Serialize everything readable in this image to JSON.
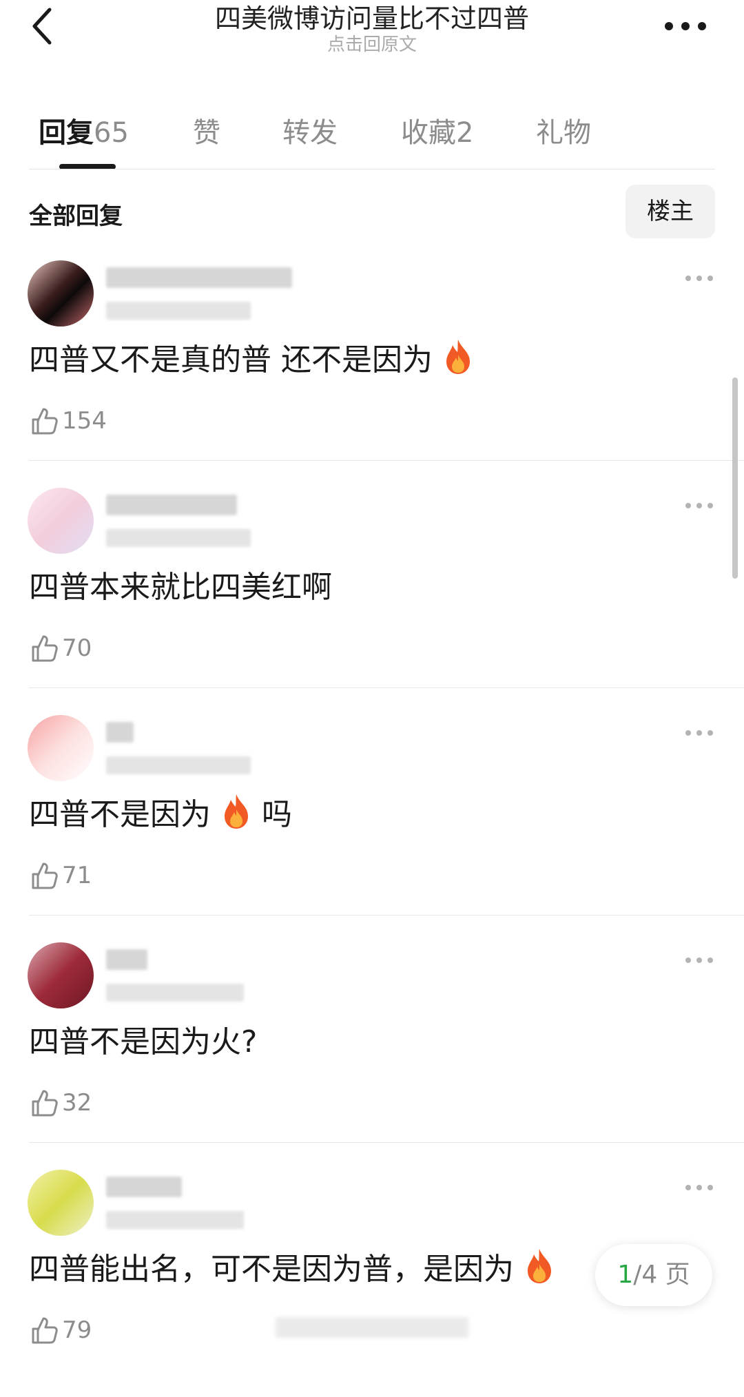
{
  "header": {
    "title": "四美微博访问量比不过四普",
    "subtitle": "点击回原文"
  },
  "tabs": [
    {
      "label": "回复",
      "count": "65"
    },
    {
      "label": "赞",
      "count": ""
    },
    {
      "label": "转发",
      "count": ""
    },
    {
      "label": "收藏",
      "count": "2"
    },
    {
      "label": "礼物",
      "count": ""
    }
  ],
  "active_tab": "回复",
  "section": {
    "title": "全部回复",
    "op_button": "楼主"
  },
  "comments": [
    {
      "text": "四普又不是真的普 还不是因为",
      "emoji_after": "fire",
      "likes": "154"
    },
    {
      "text": "四普本来就比四美红啊",
      "likes": "70"
    },
    {
      "text_before": "四普不是因为",
      "emoji": "fire",
      "text_after": "吗",
      "likes": "71"
    },
    {
      "text": "四普不是因为火?",
      "likes": "32"
    },
    {
      "text": "四普能出名，可不是因为普，是因为",
      "emoji_after": "fire",
      "likes": "79"
    }
  ],
  "pager": {
    "current": "1",
    "total_text": "/4 页"
  },
  "colors": {
    "accent_green": "#27a843",
    "text_gray": "#8c8c8c",
    "divider": "#e8e8e8"
  },
  "icons": {
    "back": "chevron-left-icon",
    "more": "more-dots-icon",
    "like": "thumbs-up-icon",
    "fire": "fire-emoji"
  }
}
